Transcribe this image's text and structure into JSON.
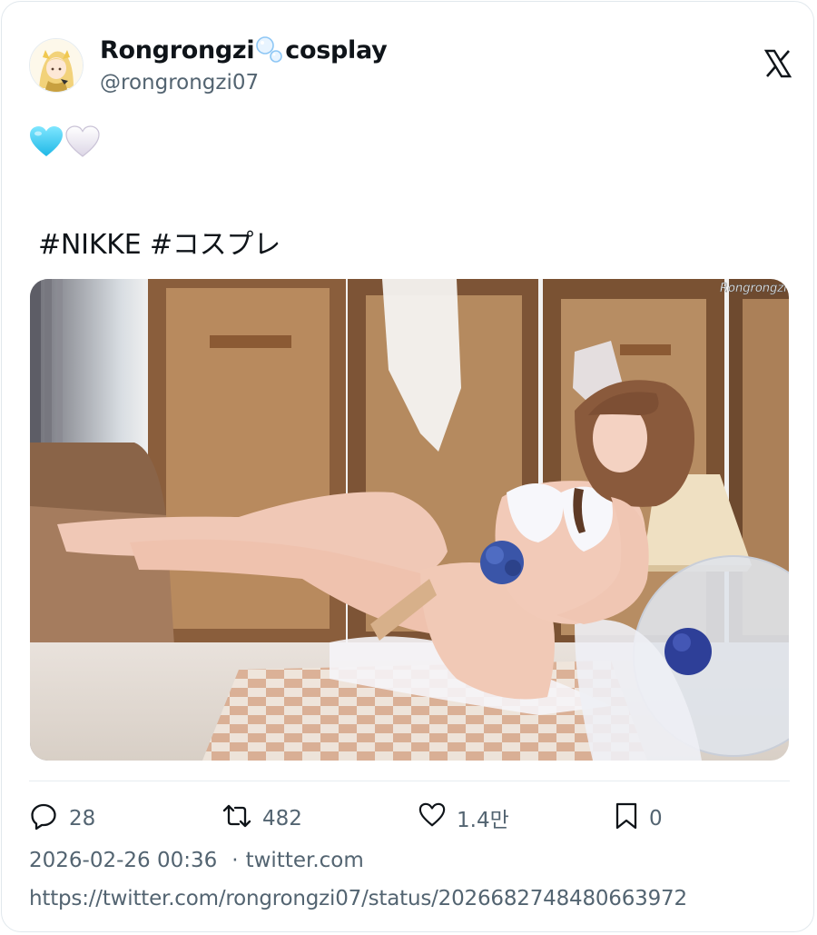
{
  "author": {
    "display_name_part1": "Rongrongzi",
    "display_name_part2": "cosplay",
    "name_emoji": "bubbles-icon",
    "handle": "@rongrongzi07",
    "platform_icon": "x-logo-icon"
  },
  "tweet": {
    "emojis": [
      "light-blue-heart-icon",
      "white-heart-icon"
    ],
    "hashtags": "#NIKKE #コスプレ",
    "image_watermark": "Rongrongzi",
    "image_alt": "cosplay photo"
  },
  "actions": {
    "replies": "28",
    "retweets": "482",
    "likes": "1.4만",
    "bookmarks": "0"
  },
  "meta": {
    "timestamp": "2026-02-26 00:36",
    "separator": "·",
    "source": "twitter.com",
    "url": "https://twitter.com/rongrongzi07/status/2026682748480663972"
  },
  "colors": {
    "text": "#0f1419",
    "secondary": "#536471",
    "border": "#e1e8ed"
  }
}
